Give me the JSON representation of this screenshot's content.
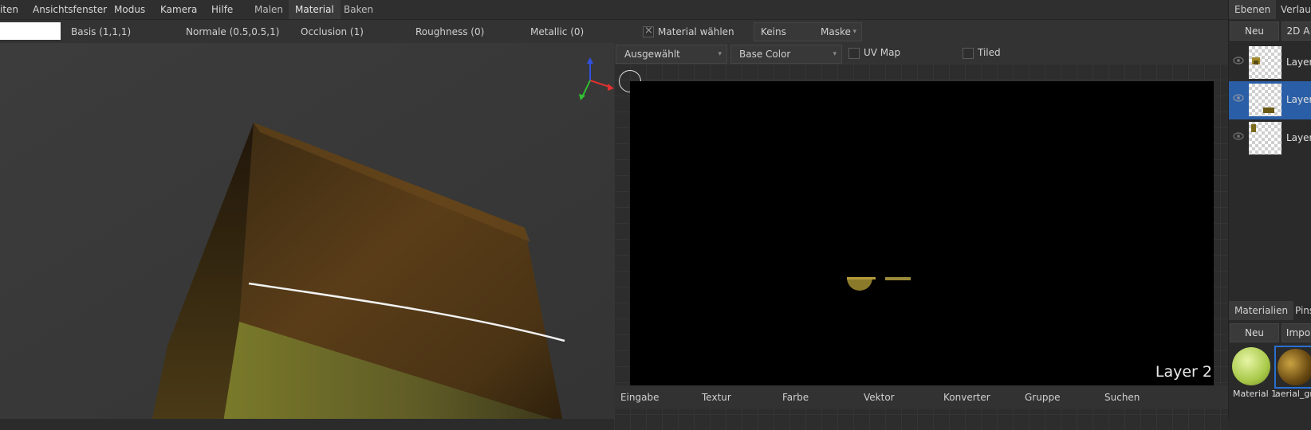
{
  "menubar": {
    "items": [
      "iten",
      "Ansichtsfenster",
      "Modus",
      "Kamera",
      "Hilfe"
    ],
    "workspace_tabs": [
      "Malen",
      "Material",
      "Baken"
    ],
    "active_tab": "Material"
  },
  "toolbar": {
    "outputs": [
      "Basis (1,1,1)",
      "Normale (0.5,0.5,1)",
      "Occlusion (1)",
      "Roughness (0)",
      "Metallic (0)"
    ],
    "material_select_label": "Material wählen",
    "mask_value": "Keins",
    "mask_label": "Maske"
  },
  "editor2d": {
    "selection_value": "Ausgewählt",
    "channel_value": "Base Color",
    "uv_map_label": "UV Map",
    "tiled_label": "Tiled",
    "overlay_label": "Layer 2",
    "node_categories": [
      "Eingabe",
      "Textur",
      "Farbe",
      "Vektor",
      "Konverter",
      "Gruppe",
      "Suchen"
    ]
  },
  "rightpanel": {
    "tabs": [
      "Ebenen",
      "Verlauf"
    ],
    "new_label": "Neu",
    "layer_2d_label": "2D A",
    "layers": [
      "Layer",
      "Layer",
      "Layer"
    ],
    "materials_tab": "Materialien",
    "brushes_tab": "Pins",
    "materials_new": "Neu",
    "materials_import": "Impo",
    "materials": [
      "Material 1",
      "aerial_gra"
    ]
  },
  "colors": {
    "accent": "#2a5ea6",
    "axis_x": "#e03030",
    "axis_y": "#30c030",
    "axis_z": "#3050e0"
  }
}
